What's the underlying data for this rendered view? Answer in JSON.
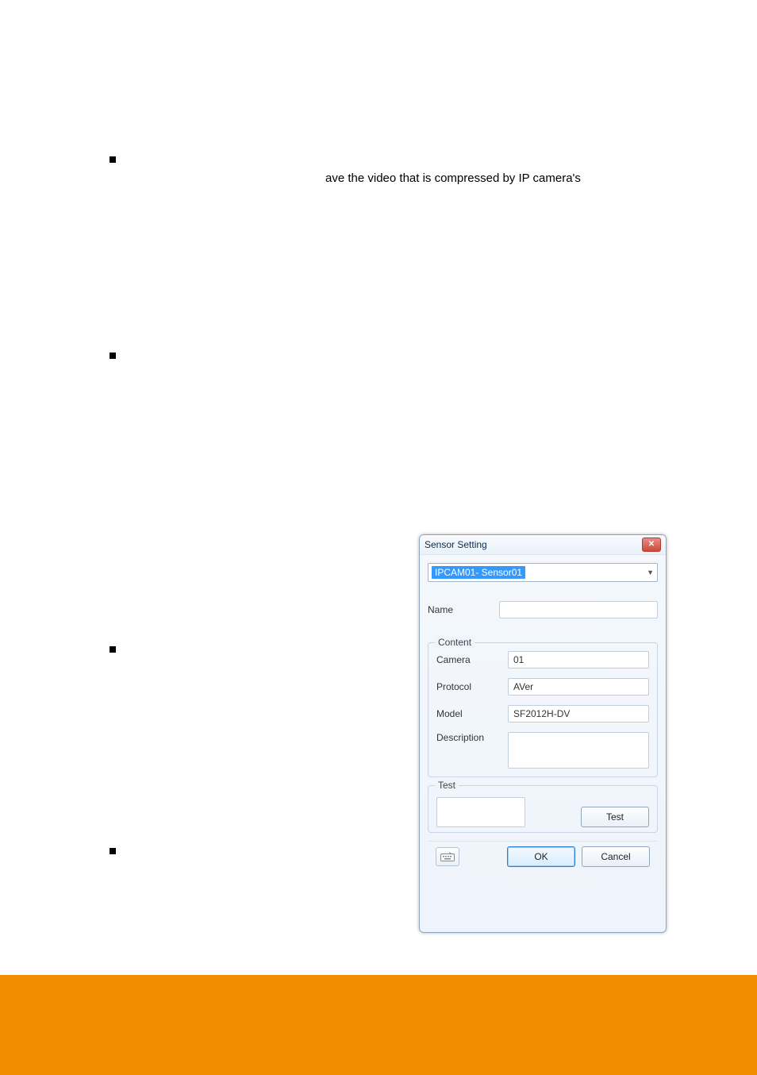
{
  "text": {
    "line1": "ave  the  video  that  is  compressed  by  IP  camera's",
    "blk1_prefix_hidden": "",
    "dialog_title": "Sensor Setting",
    "combo_value": "IPCAM01- Sensor01",
    "labels": {
      "name": "Name",
      "content": "Content",
      "camera": "Camera",
      "protocol": "Protocol",
      "model": "Model",
      "description": "Description",
      "test_group": "Test",
      "test_btn": "Test",
      "ok": "OK",
      "cancel": "Cancel"
    },
    "values": {
      "name": "",
      "camera": "01",
      "protocol": "AVer",
      "model": "SF2012H-DV",
      "description": ""
    }
  }
}
